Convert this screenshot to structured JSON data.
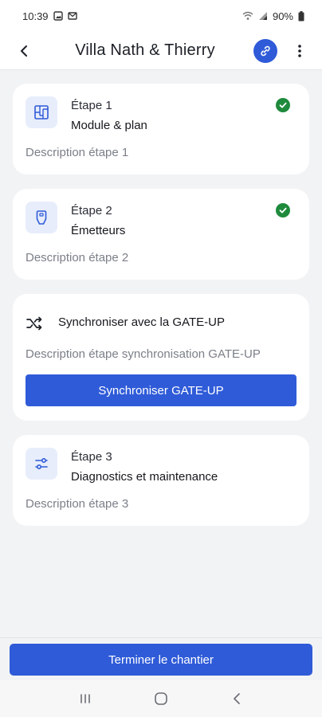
{
  "status_bar": {
    "time": "10:39",
    "battery": "90%"
  },
  "app_bar": {
    "title": "Villa Nath & Thierry"
  },
  "steps": [
    {
      "step_label": "Étape 1",
      "name": "Module & plan",
      "description": "Description étape 1",
      "completed": true,
      "icon": "plan-icon"
    },
    {
      "step_label": "Étape 2",
      "name": "Émetteurs",
      "description": "Description étape 2",
      "completed": true,
      "icon": "remote-icon"
    }
  ],
  "sync": {
    "title": "Synchroniser avec la GATE-UP",
    "description": "Description étape synchronisation GATE-UP",
    "button_label": "Synchroniser GATE-UP",
    "icon": "shuffle-icon"
  },
  "step3": {
    "step_label": "Étape 3",
    "name": "Diagnostics et maintenance",
    "description": "Description étape 3",
    "icon": "sliders-icon"
  },
  "footer": {
    "finish_label": "Terminer le chantier"
  },
  "colors": {
    "primary": "#2f5bd8",
    "success": "#1e8a3c",
    "icon_bg": "#e7edfb",
    "page_bg": "#f2f3f5"
  }
}
